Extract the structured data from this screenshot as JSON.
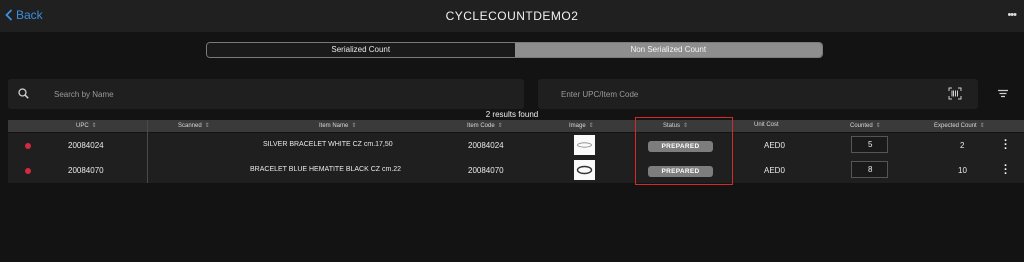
{
  "header": {
    "back_label": "Back",
    "title": "CYCLECOUNTDEMO2",
    "more_label": "•••"
  },
  "tabs": [
    {
      "label": "Serialized Count",
      "active": false
    },
    {
      "label": "Non Serialized Count",
      "active": true
    }
  ],
  "search": {
    "name_placeholder": "Search by Name",
    "upc_placeholder": "Enter UPC/Item Code"
  },
  "results_text": "2 results found",
  "table": {
    "columns": [
      "UPC",
      "Scanned",
      "Item Name",
      "Item Code",
      "Image",
      "Status",
      "Unit Cost",
      "Counted",
      "Expected Count"
    ],
    "sort_glyph": "⇕",
    "rows": [
      {
        "upc": "20084024",
        "item_name": "SILVER BRACELET WHITE CZ cm.17,50",
        "item_code": "20084024",
        "status": "PREPARED",
        "unit_cost": "AED0",
        "counted": "5",
        "expected": "2"
      },
      {
        "upc": "20084070",
        "item_name": "BRACELET BLUE HEMATITE BLACK CZ cm.22",
        "item_code": "20084070",
        "status": "PREPARED",
        "unit_cost": "AED0",
        "counted": "8",
        "expected": "10"
      }
    ]
  },
  "colors": {
    "accent": "#3b8fe0",
    "status_dot": "#d6283f",
    "highlight": "#d42a2a"
  },
  "icons": [
    "back-chevron-icon",
    "search-icon",
    "barcode-scan-icon",
    "filter-icon",
    "more-icon",
    "kebab-icon"
  ]
}
